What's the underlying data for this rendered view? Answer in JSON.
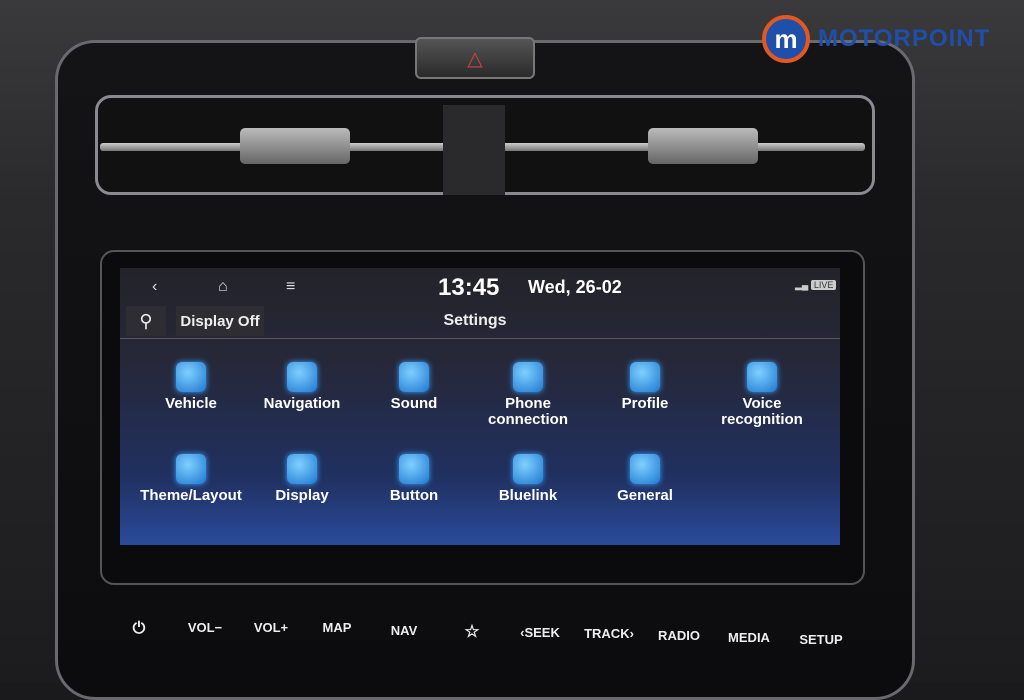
{
  "brand": {
    "name": "MOTORPOINT",
    "mark": "m"
  },
  "status_bar": {
    "back_icon": "chevron-left-icon",
    "home_icon": "home-icon",
    "menu_icon": "menu-icon",
    "time": "13:45",
    "date": "Wed, 26-02",
    "signal_icon": "signal-icon",
    "live_badge": "LIVE"
  },
  "toolbar": {
    "search_icon": "search-icon",
    "display_off": "Display Off",
    "title": "Settings"
  },
  "settings_items": [
    {
      "label": "Vehicle",
      "icon": "car-gear-icon"
    },
    {
      "label": "Navigation",
      "icon": "navigation-icon"
    },
    {
      "label": "Sound",
      "icon": "speaker-icon"
    },
    {
      "label": "Phone connection",
      "icon": "phone-icon"
    },
    {
      "label": "Profile",
      "icon": "profile-icon"
    },
    {
      "label": "Voice recognition",
      "icon": "microphone-icon"
    },
    {
      "label": "Theme/Layout",
      "icon": "theme-icon"
    },
    {
      "label": "Display",
      "icon": "display-icon"
    },
    {
      "label": "Button",
      "icon": "button-hand-icon"
    },
    {
      "label": "Bluelink",
      "icon": "bluelink-icon"
    },
    {
      "label": "General",
      "icon": "gear-icon"
    }
  ],
  "hard_buttons": {
    "power": "⏻",
    "vol_down": "VOL−",
    "vol_up": "VOL+",
    "map": "MAP",
    "nav": "NAV",
    "favorite": "☆",
    "seek": "‹SEEK",
    "track": "TRACK›",
    "radio": "RADIO",
    "media": "MEDIA",
    "setup": "SETUP"
  }
}
